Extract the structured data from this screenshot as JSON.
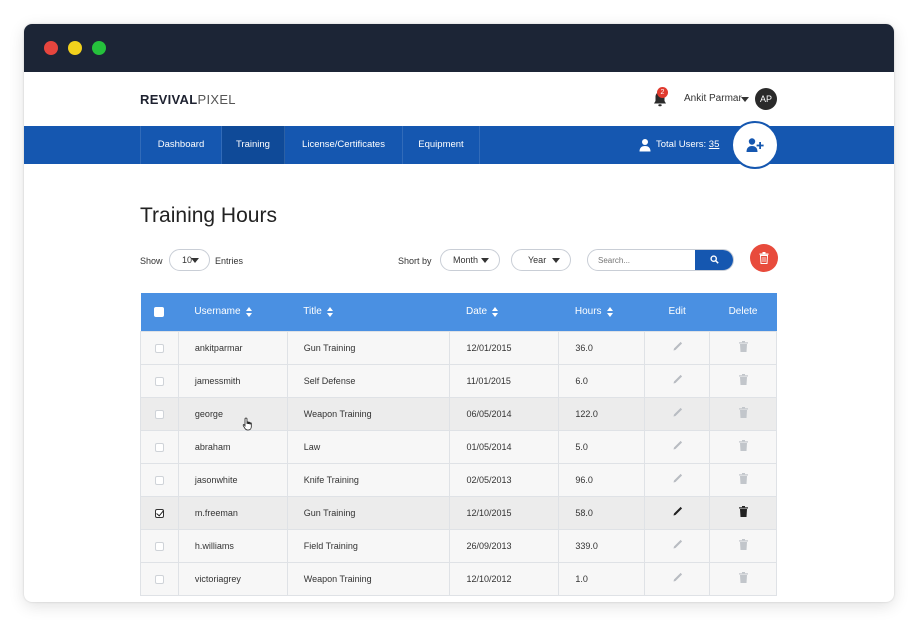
{
  "header": {
    "logo_bold": "REVIVAL",
    "logo_light": "PIXEL",
    "notification_count": "2",
    "user_name": "Ankit Parmar",
    "avatar_initials": "AP"
  },
  "nav": {
    "items": [
      {
        "label": "Dashboard"
      },
      {
        "label": "Training"
      },
      {
        "label": "License/Certificates"
      },
      {
        "label": "Equipment"
      }
    ],
    "active": "Training",
    "total_users_label": "Total Users:",
    "total_users_count": "35"
  },
  "page": {
    "title": "Training Hours"
  },
  "controls": {
    "show_label": "Show",
    "entries_value": "10",
    "entries_label": "Entries",
    "sort_label": "Short by",
    "month_label": "Month",
    "year_label": "Year",
    "search_placeholder": "Search..."
  },
  "table": {
    "columns": [
      "Username",
      "Title",
      "Date",
      "Hours",
      "Edit",
      "Delete"
    ],
    "rows": [
      {
        "username": "ankitparmar",
        "title": "Gun Training",
        "date": "12/01/2015",
        "hours": "36.0",
        "checked": false
      },
      {
        "username": "jamessmith",
        "title": "Self Defense",
        "date": "11/01/2015",
        "hours": "6.0",
        "checked": false
      },
      {
        "username": "george",
        "title": "Weapon Training",
        "date": "06/05/2014",
        "hours": "122.0",
        "checked": false
      },
      {
        "username": "abraham",
        "title": "Law",
        "date": "01/05/2014",
        "hours": "5.0",
        "checked": false
      },
      {
        "username": "jasonwhite",
        "title": "Knife Training",
        "date": "02/05/2013",
        "hours": "96.0",
        "checked": false
      },
      {
        "username": "m.freeman",
        "title": "Gun Training",
        "date": "12/10/2015",
        "hours": "58.0",
        "checked": true
      },
      {
        "username": "h.williams",
        "title": "Field Training",
        "date": "26/09/2013",
        "hours": "339.0",
        "checked": false
      },
      {
        "username": "victoriagrey",
        "title": "Weapon Training",
        "date": "12/10/2012",
        "hours": "1.0",
        "checked": false
      }
    ]
  },
  "colors": {
    "titlebar": "#1c2536",
    "nav": "#1557b0",
    "table_header": "#4a90e2",
    "danger": "#e84b3c",
    "badge": "#e03a2e"
  }
}
